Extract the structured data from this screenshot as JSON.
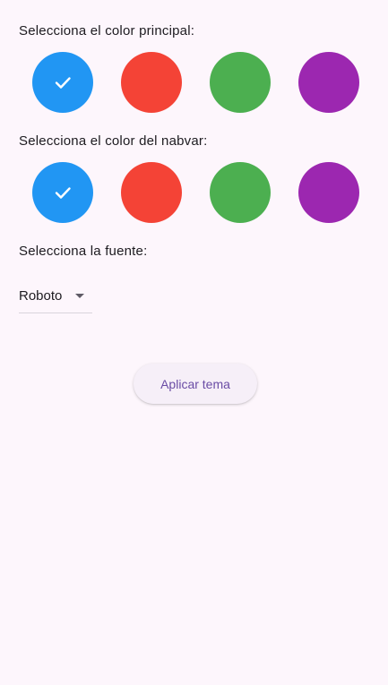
{
  "primary_color": {
    "label": "Selecciona el color principal:",
    "options": [
      {
        "color": "#2196F3",
        "selected": true
      },
      {
        "color": "#F44336",
        "selected": false
      },
      {
        "color": "#4CAF50",
        "selected": false
      },
      {
        "color": "#9C27B0",
        "selected": false
      }
    ]
  },
  "navbar_color": {
    "label": "Selecciona el color del nabvar:",
    "options": [
      {
        "color": "#2196F3",
        "selected": true
      },
      {
        "color": "#F44336",
        "selected": false
      },
      {
        "color": "#4CAF50",
        "selected": false
      },
      {
        "color": "#9C27B0",
        "selected": false
      }
    ]
  },
  "font": {
    "label": "Selecciona la fuente:",
    "selected": "Roboto"
  },
  "apply_button": {
    "label": "Aplicar tema"
  },
  "icons": {
    "selected_marker": "check-icon",
    "dropdown_marker": "dropdown-arrow-icon"
  }
}
